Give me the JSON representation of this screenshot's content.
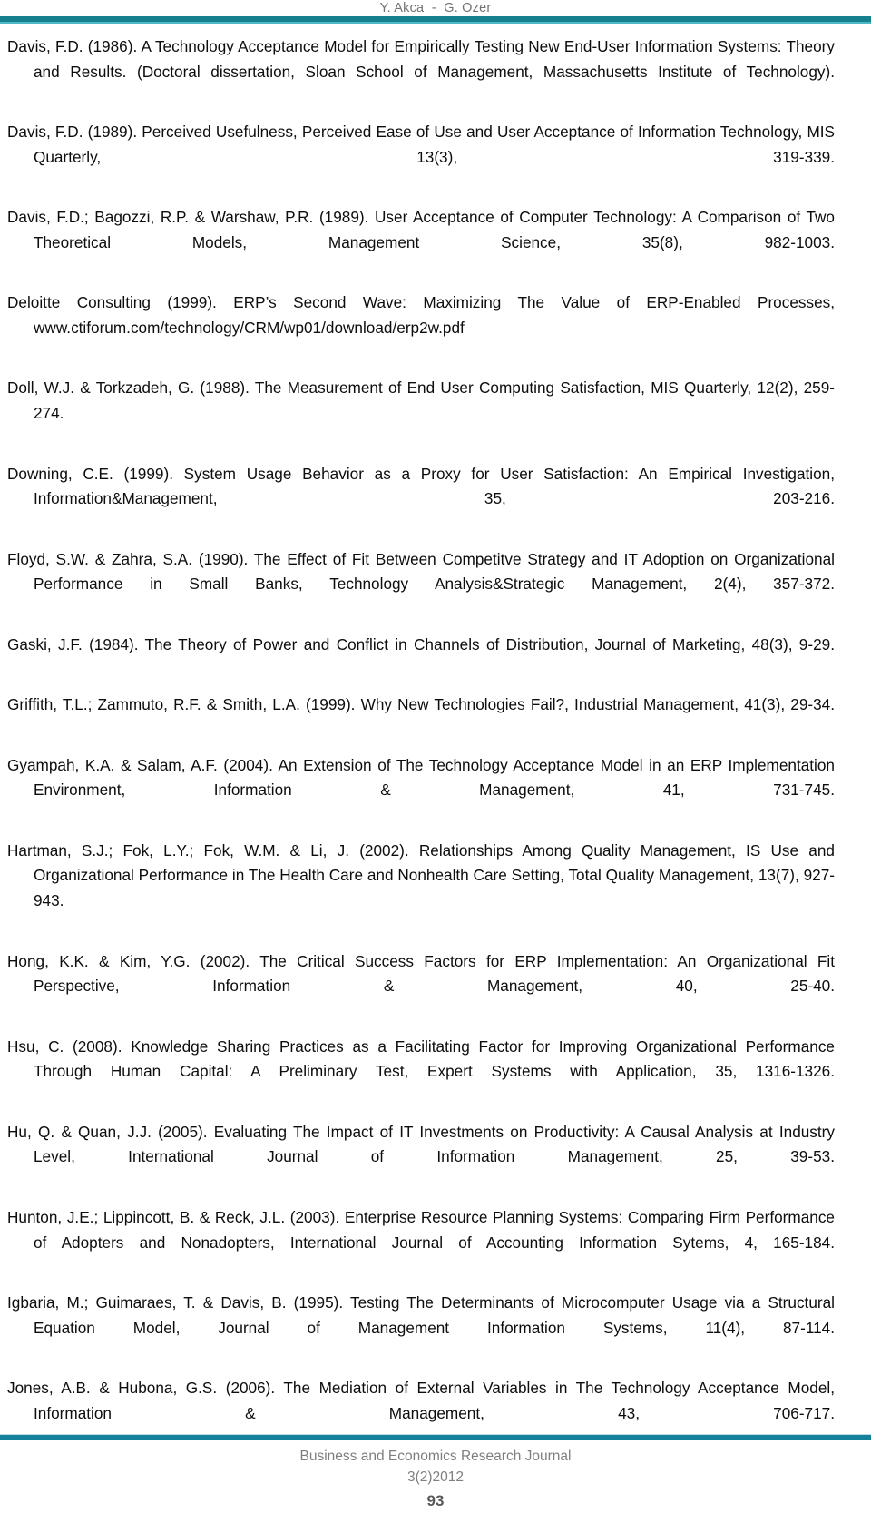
{
  "header": {
    "running_head": "Y. Akca  -  G. Ozer",
    "rule_color": "#17808f",
    "rule_accent_color": "#4fb6c4"
  },
  "footer": {
    "journal": "Business and Economics Research Journal",
    "issue": "3(2)2012",
    "page_number": "93",
    "rule_color": "#15819a"
  },
  "references": [
    {
      "id": "davis-1986",
      "text": "Davis, F.D. (1986). A Technology Acceptance Model for Empirically Testing New End-User Information Systems: Theory and Results. (Doctoral dissertation, Sloan School of Management, Massachusetts Institute of Technology)."
    },
    {
      "id": "davis-1989",
      "text": "Davis, F.D. (1989). Perceived Usefulness, Perceived Ease of Use and User Acceptance of Information Technology, MIS Quarterly, 13(3), 319-339."
    },
    {
      "id": "davis-bagozzi-warshaw-1989",
      "text": "Davis, F.D.; Bagozzi, R.P. & Warshaw, P.R. (1989). User Acceptance of Computer Technology: A Comparison of Two Theoretical Models, Management Science, 35(8), 982-1003."
    },
    {
      "id": "deloitte-1999",
      "text": "Deloitte Consulting (1999). ERP’s Second Wave: Maximizing The Value of ERP-Enabled Processes, www.ctiforum.com/technology/CRM/wp01/download/erp2w.pdf"
    },
    {
      "id": "doll-torkzadeh-1988",
      "text": "Doll, W.J. & Torkzadeh, G. (1988). The Measurement of End User Computing Satisfaction, MIS Quarterly, 12(2), 259-274."
    },
    {
      "id": "downing-1999",
      "text": "Downing, C.E. (1999). System Usage Behavior as a Proxy for User Satisfaction: An Empirical Investigation, Information&Management, 35, 203-216."
    },
    {
      "id": "floyd-zahra-1990",
      "text": "Floyd, S.W. & Zahra, S.A. (1990). The Effect of Fit Between Competitve Strategy and IT Adoption on Organizational Performance in Small Banks, Technology Analysis&Strategic Management, 2(4), 357-372."
    },
    {
      "id": "gaski-1984",
      "text": "Gaski, J.F. (1984). The Theory of Power and Conflict in Channels of Distribution, Journal of Marketing, 48(3), 9-29."
    },
    {
      "id": "griffith-zammuto-smith-1999",
      "text": "Griffith, T.L.; Zammuto, R.F. & Smith, L.A. (1999). Why New Technologies Fail?, Industrial Management, 41(3), 29-34."
    },
    {
      "id": "gyampah-salam-2004",
      "text": "Gyampah, K.A. & Salam, A.F. (2004). An Extension of The Technology Acceptance Model in an ERP Implementation Environment, Information & Management, 41, 731-745."
    },
    {
      "id": "hartman-fok-fok-li-2002",
      "text": "Hartman, S.J.; Fok, L.Y.; Fok, W.M. & Li, J. (2002). Relationships Among Quality Management, IS Use and Organizational Performance in The Health Care and Nonhealth Care Setting, Total Quality Management, 13(7), 927-943."
    },
    {
      "id": "hong-kim-2002",
      "text": "Hong, K.K. & Kim, Y.G. (2002). The Critical Success Factors for ERP Implementation: An Organizational Fit Perspective, Information & Management, 40, 25-40."
    },
    {
      "id": "hsu-2008",
      "text": "Hsu, C. (2008). Knowledge Sharing Practices as a Facilitating Factor for Improving Organizational Performance Through Human Capital: A Preliminary Test, Expert Systems with Application, 35, 1316-1326."
    },
    {
      "id": "hu-quan-2005",
      "text": "Hu, Q. & Quan, J.J. (2005). Evaluating The Impact of IT Investments on Productivity: A Causal Analysis at Industry Level, International Journal of Information Management, 25, 39-53."
    },
    {
      "id": "hunton-lippincott-reck-2003",
      "text": "Hunton, J.E.; Lippincott, B. & Reck, J.L. (2003). Enterprise Resource Planning Systems: Comparing Firm Performance of Adopters and Nonadopters, International Journal of Accounting Information Sytems, 4, 165-184."
    },
    {
      "id": "igbaria-guimaraes-davis-1995",
      "text": "Igbaria, M.; Guimaraes, T. & Davis, B. (1995). Testing The Determinants of Microcomputer Usage via a Structural Equation Model, Journal of Management Information Systems, 11(4), 87-114."
    },
    {
      "id": "jones-hubona-2006",
      "text": "Jones, A.B. & Hubona, G.S. (2006). The Mediation of External Variables in The Technology Acceptance Model, Information & Management, 43, 706-717."
    }
  ]
}
